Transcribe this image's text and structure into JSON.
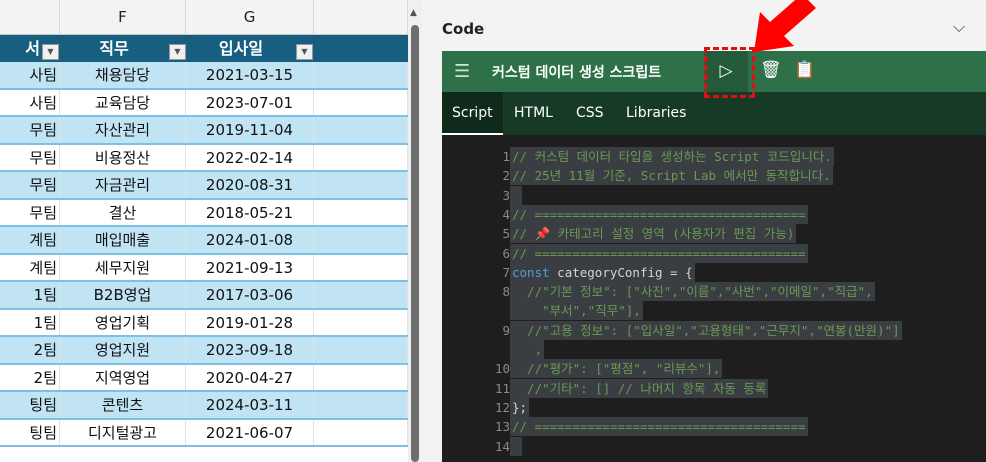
{
  "sheet": {
    "columns": [
      "F",
      "G"
    ],
    "headers": [
      "서",
      "직무",
      "입사일"
    ],
    "rows": [
      [
        "사팀",
        "채용담당",
        "2021-03-15"
      ],
      [
        "사팀",
        "교육담당",
        "2023-07-01"
      ],
      [
        "무팀",
        "자산관리",
        "2019-11-04"
      ],
      [
        "무팀",
        "비용정산",
        "2022-02-14"
      ],
      [
        "무팀",
        "자금관리",
        "2020-08-31"
      ],
      [
        "무팀",
        "결산",
        "2018-05-21"
      ],
      [
        "계팀",
        "매입매출",
        "2024-01-08"
      ],
      [
        "계팀",
        "세무지원",
        "2021-09-13"
      ],
      [
        "1팀",
        "B2B영업",
        "2017-03-06"
      ],
      [
        "1팀",
        "영업기획",
        "2019-01-28"
      ],
      [
        "2팀",
        "영업지원",
        "2023-09-18"
      ],
      [
        "2팀",
        "지역영업",
        "2020-04-27"
      ],
      [
        "팅팀",
        "콘텐츠",
        "2024-03-11"
      ],
      [
        "팅팀",
        "디지털광고",
        "2021-06-07"
      ]
    ]
  },
  "pane": {
    "title": "Code",
    "snippet_name": "커스텀 데이터 생성 스크립트",
    "tabs": [
      "Script",
      "HTML",
      "CSS",
      "Libraries"
    ],
    "lines": [
      {
        "n": "1",
        "t": "// 커스텀 데이터 타입을 생성하는 Script 코드입니다."
      },
      {
        "n": "2",
        "t": "// 25년 11월 기준, Script Lab 에서만 동작합니다."
      },
      {
        "n": "3",
        "t": " "
      },
      {
        "n": "4",
        "t": "// ===================================="
      },
      {
        "n": "5",
        "t": "// 📌 카테고리 설정 영역 (사용자가 편집 가능)"
      },
      {
        "n": "6",
        "t": "// ===================================="
      },
      {
        "n": "7",
        "kw": "const",
        "t": " categoryConfig = {"
      },
      {
        "n": "8",
        "t": "  //\"기본 정보\": [\"사진\",\"이름\",\"사번\",\"이메일\",\"직급\","
      },
      {
        "n": "",
        "t": "    \"부서\",\"직무\"],"
      },
      {
        "n": "9",
        "t": "  //\"고용 정보\": [\"입사일\",\"고용형태\",\"근무지\",\"연봉(만원)\"]"
      },
      {
        "n": "",
        "t": "   ,"
      },
      {
        "n": "10",
        "t": "  //\"평가\": [\"평점\", \"리뷰수\"],"
      },
      {
        "n": "11",
        "t": "  //\"기타\": [] // 나머지 항목 자동 등록"
      },
      {
        "n": "12",
        "t": "};"
      },
      {
        "n": "13",
        "t": "// ===================================="
      },
      {
        "n": "14",
        "t": " "
      }
    ]
  }
}
